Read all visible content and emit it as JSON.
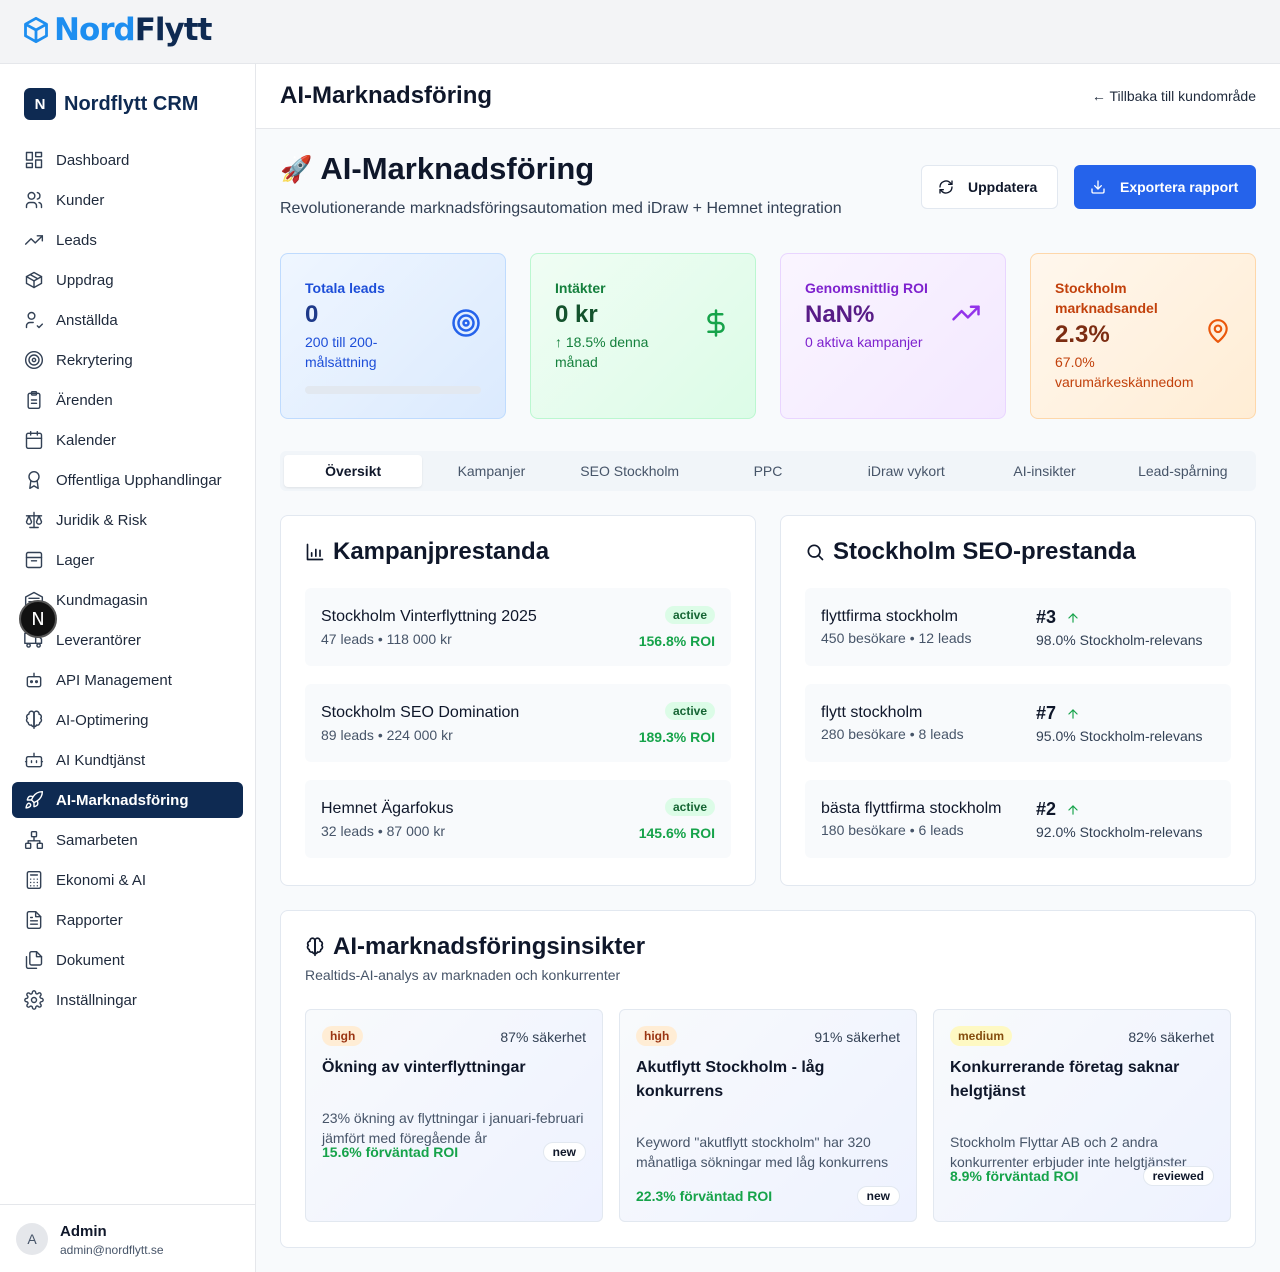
{
  "brand": {
    "part1": "Nord",
    "part2": "Flytt"
  },
  "sidebar": {
    "crm_badge": "N",
    "crm_title": "Nordflytt CRM",
    "items": [
      {
        "label": "Dashboard",
        "icon": "dashboard-icon"
      },
      {
        "label": "Kunder",
        "icon": "users-icon"
      },
      {
        "label": "Leads",
        "icon": "trending-up-icon"
      },
      {
        "label": "Uppdrag",
        "icon": "package-icon"
      },
      {
        "label": "Anställda",
        "icon": "user-check-icon"
      },
      {
        "label": "Rekrytering",
        "icon": "target-icon"
      },
      {
        "label": "Ärenden",
        "icon": "clipboard-icon"
      },
      {
        "label": "Kalender",
        "icon": "calendar-icon"
      },
      {
        "label": "Offentliga Upphandlingar",
        "icon": "award-icon"
      },
      {
        "label": "Juridik & Risk",
        "icon": "scale-icon"
      },
      {
        "label": "Lager",
        "icon": "archive-icon"
      },
      {
        "label": "Kundmagasin",
        "icon": "warehouse-icon"
      },
      {
        "label": "Leverantörer",
        "icon": "truck-icon"
      },
      {
        "label": "API Management",
        "icon": "bot-icon"
      },
      {
        "label": "AI-Optimering",
        "icon": "brain-icon"
      },
      {
        "label": "AI Kundtjänst",
        "icon": "robot-icon"
      },
      {
        "label": "AI-Marknadsföring",
        "icon": "rocket-icon"
      },
      {
        "label": "Samarbeten",
        "icon": "network-icon"
      },
      {
        "label": "Ekonomi & AI",
        "icon": "calculator-icon"
      },
      {
        "label": "Rapporter",
        "icon": "file-text-icon"
      },
      {
        "label": "Dokument",
        "icon": "files-icon"
      },
      {
        "label": "Inställningar",
        "icon": "settings-icon"
      }
    ],
    "active_index": 16,
    "dev_badge": "N",
    "user": {
      "initial": "A",
      "name": "Admin",
      "email": "admin@nordflytt.se"
    }
  },
  "header": {
    "title": "AI-Marknadsföring",
    "back_link": "← Tillbaka till kundområde"
  },
  "hero": {
    "emoji": "🚀",
    "title": "AI-Marknadsföring",
    "subtitle": "Revolutionerande marknadsföringsautomation med iDraw + Hemnet integration",
    "update_button": "Uppdatera",
    "export_button": "Exportera rapport"
  },
  "stats": [
    {
      "label": "Totala leads",
      "value": "0",
      "sub": "200 till 200-målsättning",
      "progress": 0,
      "icon": "target-icon"
    },
    {
      "label": "Intäkter",
      "value": "0 kr",
      "sub": "↑ 18.5% denna månad",
      "icon": "dollar-icon"
    },
    {
      "label": "Genomsnittlig ROI",
      "value": "NaN%",
      "sub": "0 aktiva kampanjer",
      "icon": "trending-up-icon"
    },
    {
      "label": "Stockholm marknadsandel",
      "value": "2.3%",
      "sub": "67.0% varumärkeskännedom",
      "icon": "map-pin-icon"
    }
  ],
  "tabs": [
    "Översikt",
    "Kampanjer",
    "SEO Stockholm",
    "PPC",
    "iDraw vykort",
    "AI-insikter",
    "Lead-spårning"
  ],
  "campaigns": {
    "title": "Kampanjprestanda",
    "items": [
      {
        "name": "Stockholm Vinterflyttning 2025",
        "meta": "47 leads • 118 000 kr",
        "status": "active",
        "roi": "156.8% ROI"
      },
      {
        "name": "Stockholm SEO Domination",
        "meta": "89 leads • 224 000 kr",
        "status": "active",
        "roi": "189.3% ROI"
      },
      {
        "name": "Hemnet Ägarfokus",
        "meta": "32 leads • 87 000 kr",
        "status": "active",
        "roi": "145.6% ROI"
      }
    ]
  },
  "seo": {
    "title": "Stockholm SEO-prestanda",
    "items": [
      {
        "keyword": "flyttfirma stockholm",
        "meta": "450 besökare • 12 leads",
        "rank": "#3",
        "relevance": "98.0% Stockholm-relevans"
      },
      {
        "keyword": "flytt stockholm",
        "meta": "280 besökare • 8 leads",
        "rank": "#7",
        "relevance": "95.0% Stockholm-relevans"
      },
      {
        "keyword": "bästa flyttfirma stockholm",
        "meta": "180 besökare • 6 leads",
        "rank": "#2",
        "relevance": "92.0% Stockholm-relevans"
      }
    ]
  },
  "insights": {
    "title": "AI-marknadsföringsinsikter",
    "subtitle": "Realtids-AI-analys av marknaden och konkurrenter",
    "items": [
      {
        "priority": "high",
        "confidence": "87% säkerhet",
        "title": "Ökning av vinterflyttningar",
        "description": "23% ökning av flyttningar i januari-februari jämfört med föregående år",
        "roi": "15.6% förväntad ROI",
        "status": "new"
      },
      {
        "priority": "high",
        "confidence": "91% säkerhet",
        "title": "Akutflytt Stockholm - låg konkurrens",
        "description": "Keyword \"akutflytt stockholm\" har 320 månatliga sökningar med låg konkurrens",
        "roi": "22.3% förväntad ROI",
        "status": "new"
      },
      {
        "priority": "medium",
        "confidence": "82% säkerhet",
        "title": "Konkurrerande företag saknar helgtjänst",
        "description": "Stockholm Flyttar AB och 2 andra konkurrenter erbjuder inte helgtjänster",
        "roi": "8.9% förväntad ROI",
        "status": "reviewed"
      }
    ]
  },
  "colors": {
    "brand_dark": "#0e2a52",
    "brand_blue": "#1d8ef0",
    "primary": "#2563eb",
    "success": "#16a34a"
  }
}
